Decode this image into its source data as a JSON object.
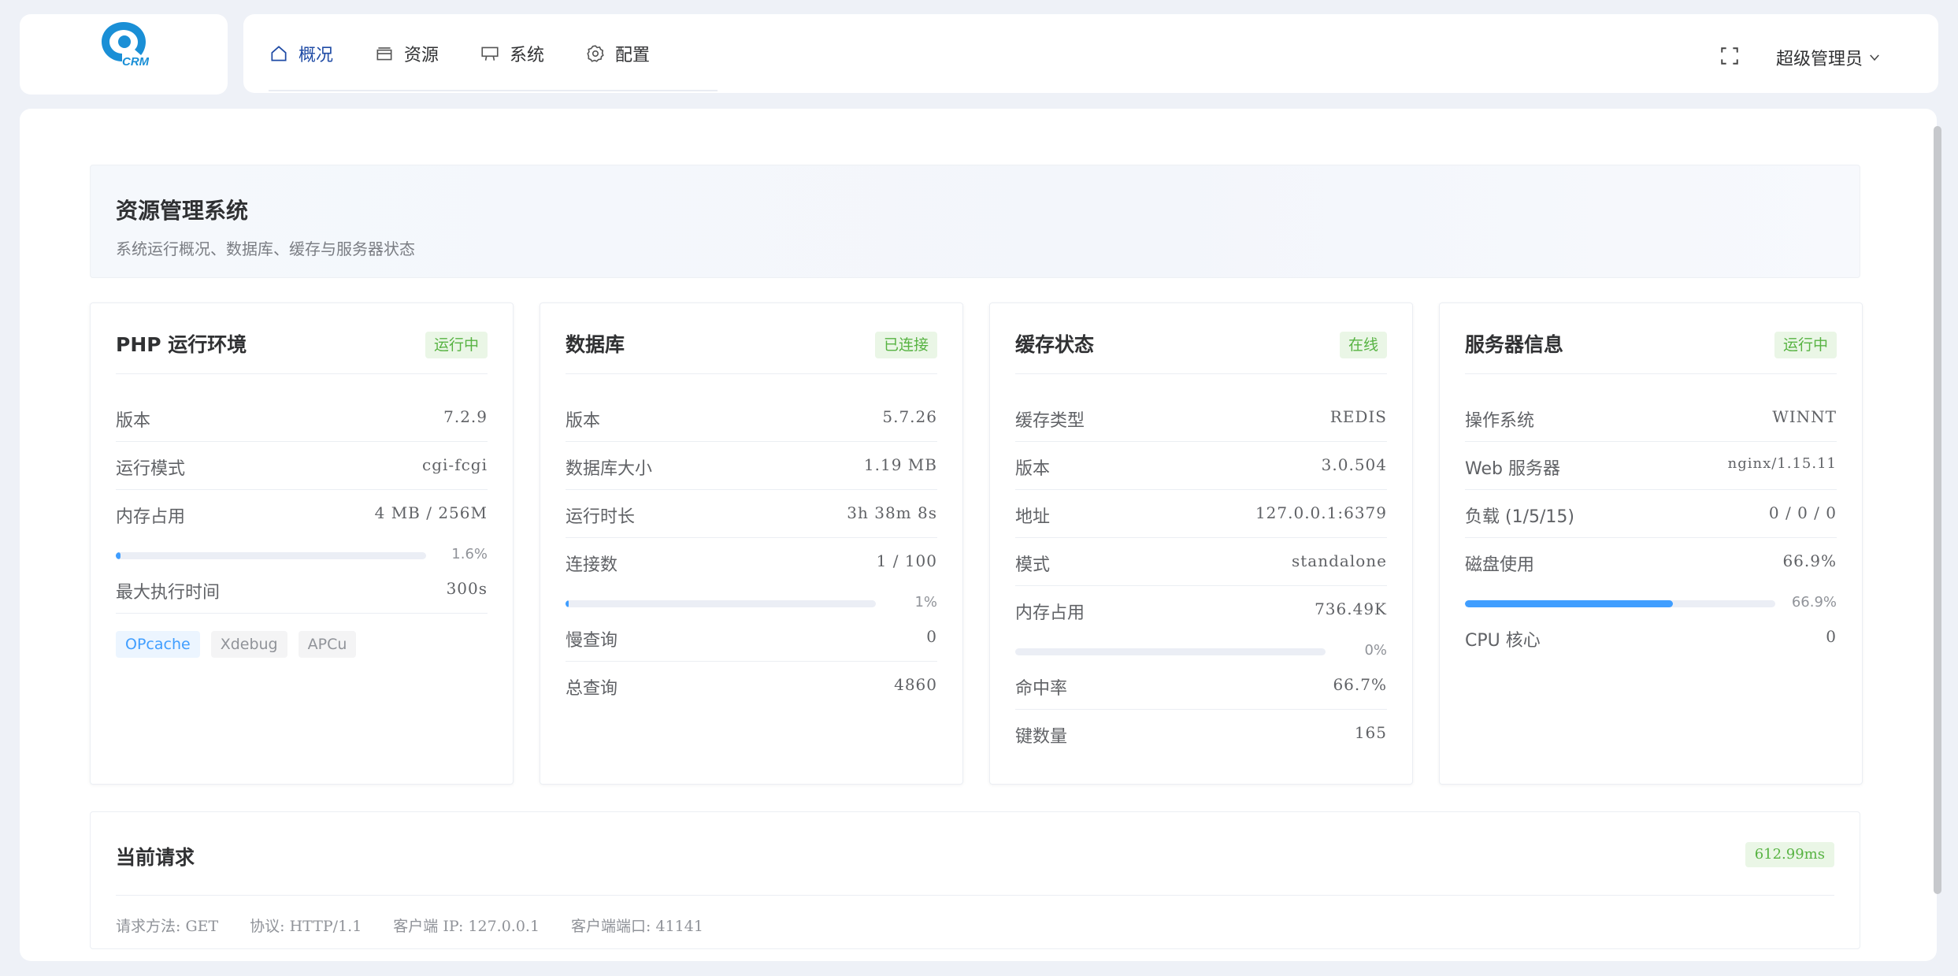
{
  "logo": {
    "text": "CRM",
    "color": "#1a8fd6"
  },
  "nav": {
    "items": [
      {
        "label": "概况",
        "icon": "home-icon",
        "active": true
      },
      {
        "label": "资源",
        "icon": "box-icon",
        "active": false
      },
      {
        "label": "系统",
        "icon": "monitor-icon",
        "active": false
      },
      {
        "label": "配置",
        "icon": "gear-icon",
        "active": false
      }
    ]
  },
  "header": {
    "user": "超级管理员",
    "fullscreen_icon": "fullscreen-icon"
  },
  "hero": {
    "title": "资源管理系统",
    "subtitle": "系统运行概况、数据库、缓存与服务器状态"
  },
  "cards": {
    "php": {
      "title": "PHP 运行环境",
      "badge": "运行中",
      "rows": [
        {
          "k": "版本",
          "v": "7.2.9"
        },
        {
          "k": "运行模式",
          "v": "cgi-fcgi"
        },
        {
          "k": "内存占用",
          "v": "4 MB / 256M"
        },
        {
          "k": "最大执行时间",
          "v": "300s"
        }
      ],
      "memory_progress": {
        "pct": 1.6,
        "label": "1.6%"
      },
      "tags": [
        "OPcache",
        "Xdebug",
        "APCu"
      ]
    },
    "db": {
      "title": "数据库",
      "badge": "已连接",
      "rows": [
        {
          "k": "版本",
          "v": "5.7.26"
        },
        {
          "k": "数据库大小",
          "v": "1.19 MB"
        },
        {
          "k": "运行时长",
          "v": "3h 38m 8s"
        },
        {
          "k": "连接数",
          "v": "1 / 100"
        },
        {
          "k": "慢查询",
          "v": "0"
        },
        {
          "k": "总查询",
          "v": "4860"
        }
      ],
      "conn_progress": {
        "pct": 1,
        "label": "1%"
      }
    },
    "cache": {
      "title": "缓存状态",
      "badge": "在线",
      "rows": [
        {
          "k": "缓存类型",
          "v": "REDIS"
        },
        {
          "k": "版本",
          "v": "3.0.504"
        },
        {
          "k": "地址",
          "v": "127.0.0.1:6379"
        },
        {
          "k": "模式",
          "v": "standalone"
        },
        {
          "k": "内存占用",
          "v": "736.49K"
        },
        {
          "k": "命中率",
          "v": "66.7%"
        },
        {
          "k": "键数量",
          "v": "165"
        }
      ],
      "mem_progress": {
        "pct": 0,
        "label": "0%"
      }
    },
    "server": {
      "title": "服务器信息",
      "badge": "运行中",
      "rows": [
        {
          "k": "操作系统",
          "v": "WINNT"
        },
        {
          "k": "Web 服务器",
          "v": "nginx/1.15.11"
        },
        {
          "k": "负载 (1/5/15)",
          "v": "0 / 0 / 0"
        },
        {
          "k": "磁盘使用",
          "v": "66.9%"
        },
        {
          "k": "CPU 核心",
          "v": "0"
        }
      ],
      "disk_progress": {
        "pct": 66.9,
        "label": "66.9%"
      }
    }
  },
  "request": {
    "title": "当前请求",
    "time": "612.99ms",
    "method": "请求方法: GET",
    "protocol": "协议: HTTP/1.1",
    "client_ip": "客户端 IP: 127.0.0.1",
    "client_port": "客户端端口: 41141"
  },
  "colors": {
    "accent": "#409eff",
    "success": "#57b342",
    "nav_active": "#1f4ba5"
  }
}
